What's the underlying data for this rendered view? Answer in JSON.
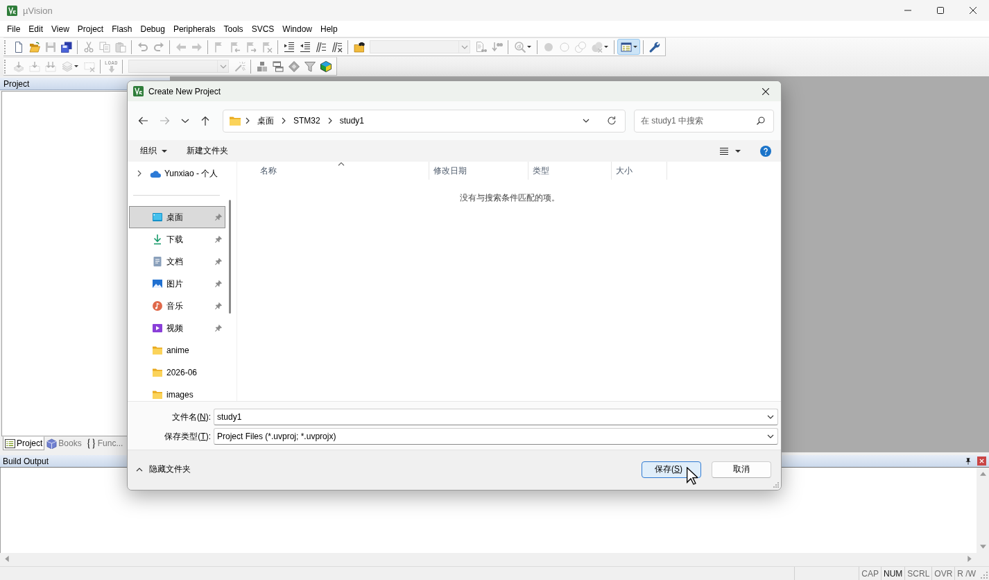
{
  "window": {
    "title": "µVision"
  },
  "menu": [
    "File",
    "Edit",
    "View",
    "Project",
    "Flash",
    "Debug",
    "Peripherals",
    "Tools",
    "SVCS",
    "Window",
    "Help"
  ],
  "toolbars": [
    {
      "items": [
        {
          "kind": "button",
          "disabled": false,
          "pressed": false
        },
        {
          "kind": "button",
          "disabled": false,
          "pressed": false
        },
        {
          "kind": "button",
          "disabled": true,
          "pressed": false
        },
        {
          "kind": "button",
          "disabled": false,
          "pressed": false
        },
        {
          "kind": "separator"
        },
        {
          "kind": "button",
          "disabled": true,
          "pressed": false
        },
        {
          "kind": "button",
          "disabled": true,
          "pressed": false
        },
        {
          "kind": "button",
          "disabled": true,
          "pressed": false
        },
        {
          "kind": "separator"
        },
        {
          "kind": "button",
          "disabled": true,
          "pressed": false
        },
        {
          "kind": "button",
          "disabled": true,
          "pressed": false
        },
        {
          "kind": "separator"
        },
        {
          "kind": "button",
          "disabled": true,
          "pressed": false
        },
        {
          "kind": "button",
          "disabled": true,
          "pressed": false
        },
        {
          "kind": "separator"
        },
        {
          "kind": "button",
          "disabled": true,
          "pressed": false
        },
        {
          "kind": "button",
          "disabled": true,
          "pressed": false
        },
        {
          "kind": "button",
          "disabled": true,
          "pressed": false
        },
        {
          "kind": "button",
          "disabled": true,
          "pressed": false
        },
        {
          "kind": "separator"
        },
        {
          "kind": "button",
          "disabled": false,
          "pressed": false
        },
        {
          "kind": "button",
          "disabled": false,
          "pressed": false
        },
        {
          "kind": "button",
          "disabled": false,
          "pressed": false
        },
        {
          "kind": "button",
          "disabled": false,
          "pressed": false
        },
        {
          "kind": "separator"
        },
        {
          "kind": "button",
          "disabled": false,
          "pressed": false
        },
        {
          "kind": "combo",
          "disabled": true
        },
        {
          "kind": "button",
          "disabled": true,
          "pressed": false
        },
        {
          "kind": "button",
          "disabled": true,
          "pressed": false
        },
        {
          "kind": "separator"
        },
        {
          "kind": "split",
          "disabled": true,
          "pressed": false
        },
        {
          "kind": "separator"
        },
        {
          "kind": "button",
          "disabled": true,
          "pressed": false
        },
        {
          "kind": "button",
          "disabled": true,
          "pressed": false
        },
        {
          "kind": "button",
          "disabled": true,
          "pressed": false
        },
        {
          "kind": "split",
          "disabled": true,
          "pressed": false
        },
        {
          "kind": "separator"
        },
        {
          "kind": "split",
          "disabled": false,
          "pressed": true
        },
        {
          "kind": "separator"
        },
        {
          "kind": "button",
          "disabled": false,
          "pressed": false
        }
      ]
    },
    {
      "items": [
        {
          "kind": "button",
          "disabled": true,
          "pressed": false
        },
        {
          "kind": "button",
          "disabled": true,
          "pressed": false
        },
        {
          "kind": "button",
          "disabled": true,
          "pressed": false
        },
        {
          "kind": "split",
          "disabled": true,
          "pressed": false
        },
        {
          "kind": "button",
          "disabled": true,
          "pressed": false
        },
        {
          "kind": "separator"
        },
        {
          "kind": "button",
          "label": "LOAD",
          "disabled": true,
          "pressed": false
        },
        {
          "kind": "separator"
        },
        {
          "kind": "combo",
          "disabled": true
        },
        {
          "kind": "button",
          "disabled": true,
          "pressed": false
        },
        {
          "kind": "separator"
        },
        {
          "kind": "button",
          "disabled": false,
          "pressed": false
        },
        {
          "kind": "button",
          "disabled": false,
          "pressed": false
        },
        {
          "kind": "button",
          "disabled": false,
          "pressed": false
        },
        {
          "kind": "button",
          "disabled": false,
          "pressed": false
        },
        {
          "kind": "button",
          "disabled": false,
          "pressed": false
        }
      ]
    }
  ],
  "project_panel": {
    "title": "Project",
    "tabs": [
      {
        "label": "Project",
        "kind": "project",
        "selected": true
      },
      {
        "label": "Books",
        "kind": "books",
        "selected": false
      },
      {
        "label": "Func...",
        "kind": "functions",
        "selected": false
      }
    ]
  },
  "dialog": {
    "title": "Create New Project",
    "nav_buttons": [
      {
        "kind": "back",
        "disabled": false
      },
      {
        "kind": "forward",
        "disabled": true
      },
      {
        "kind": "recent",
        "disabled": false
      },
      {
        "kind": "up",
        "disabled": false
      }
    ],
    "breadcrumb": [
      "桌面",
      "STM32",
      "study1"
    ],
    "search": {
      "placeholder": "在 study1 中搜索"
    },
    "commands": [
      {
        "kind": "menu",
        "label": "组织"
      },
      {
        "kind": "plain",
        "label": "新建文件夹"
      }
    ],
    "nav_pane": {
      "root": {
        "label": "Yunxiao - 个人",
        "expanded": false
      },
      "items": [
        {
          "label": "桌面",
          "kind": "desktop",
          "pinned": true,
          "selected": true
        },
        {
          "label": "下载",
          "kind": "downloads",
          "pinned": true,
          "selected": false
        },
        {
          "label": "文档",
          "kind": "documents",
          "pinned": true,
          "selected": false
        },
        {
          "label": "图片",
          "kind": "pictures",
          "pinned": true,
          "selected": false
        },
        {
          "label": "音乐",
          "kind": "music",
          "pinned": true,
          "selected": false
        },
        {
          "label": "视频",
          "kind": "videos",
          "pinned": true,
          "selected": false
        },
        {
          "label": "anime",
          "kind": "folder",
          "pinned": false,
          "selected": false
        },
        {
          "label": "2026-06",
          "kind": "folder",
          "pinned": false,
          "selected": false
        },
        {
          "label": "images",
          "kind": "folder",
          "pinned": false,
          "selected": false
        }
      ]
    },
    "columns": [
      {
        "label": "名称",
        "sorted": true
      },
      {
        "label": "修改日期",
        "sorted": false
      },
      {
        "label": "类型",
        "sorted": false
      },
      {
        "label": "大小",
        "sorted": false
      }
    ],
    "empty_message": "没有与搜索条件匹配的项。",
    "fields": [
      {
        "label": {
          "text": "文件名(",
          "key": "N",
          "end": "):"
        },
        "value": "study1"
      },
      {
        "label": {
          "text": "保存类型(",
          "key": "T",
          "end": "):"
        },
        "value": "Project Files (*.uvproj; *.uvprojx)"
      }
    ],
    "hide_folders": "隐藏文件夹",
    "buttons": [
      {
        "label": {
          "text": "保存(",
          "key": "S",
          "end": ")"
        },
        "default": true
      },
      {
        "label": {
          "text": "取消"
        },
        "default": false
      }
    ]
  },
  "build_output": {
    "title": "Build Output"
  },
  "status_bar": [
    {
      "label": "CAP",
      "on": false
    },
    {
      "label": "NUM",
      "on": true
    },
    {
      "label": "SCRL",
      "on": false
    },
    {
      "label": "OVR",
      "on": false
    },
    {
      "label": "R /W",
      "on": false
    }
  ]
}
